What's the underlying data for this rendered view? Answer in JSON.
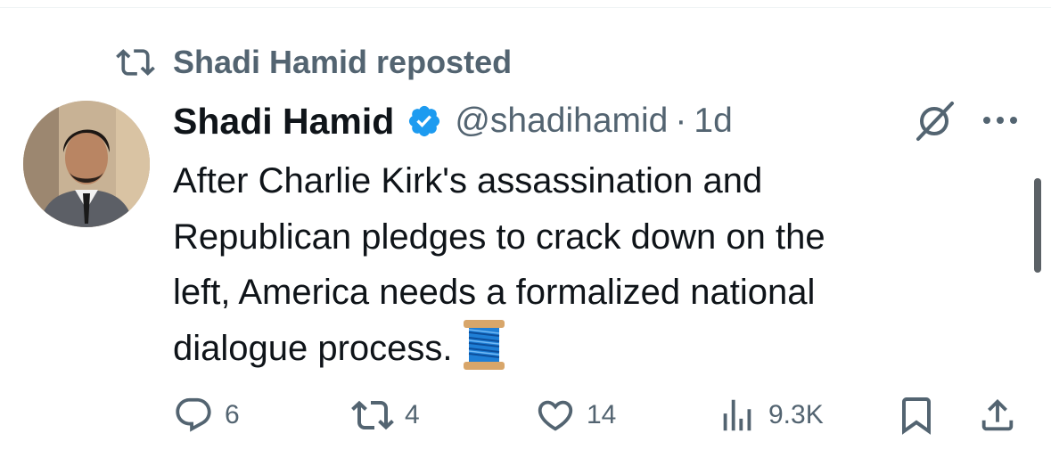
{
  "repost": {
    "text": "Shadi Hamid reposted"
  },
  "author": {
    "name": "Shadi Hamid",
    "verified": true,
    "handle": "@shadihamid",
    "separator": "·",
    "time": "1d"
  },
  "tweet": {
    "lines": [
      "After Charlie Kirk's assassination and",
      "Republican pledges to crack down on the",
      "left, America needs a formalized national",
      "dialogue process."
    ],
    "emoji": "spool-of-thread"
  },
  "actions": {
    "replies": "6",
    "reposts": "4",
    "likes": "14",
    "views": "9.3K"
  },
  "colors": {
    "text": "#0f1419",
    "muted": "#536471",
    "verified": "#1d9bf0"
  },
  "icons": [
    "repost-icon",
    "verified-badge-icon",
    "grok-icon",
    "more-icon",
    "reply-icon",
    "like-icon",
    "views-icon",
    "bookmark-icon",
    "share-icon"
  ]
}
